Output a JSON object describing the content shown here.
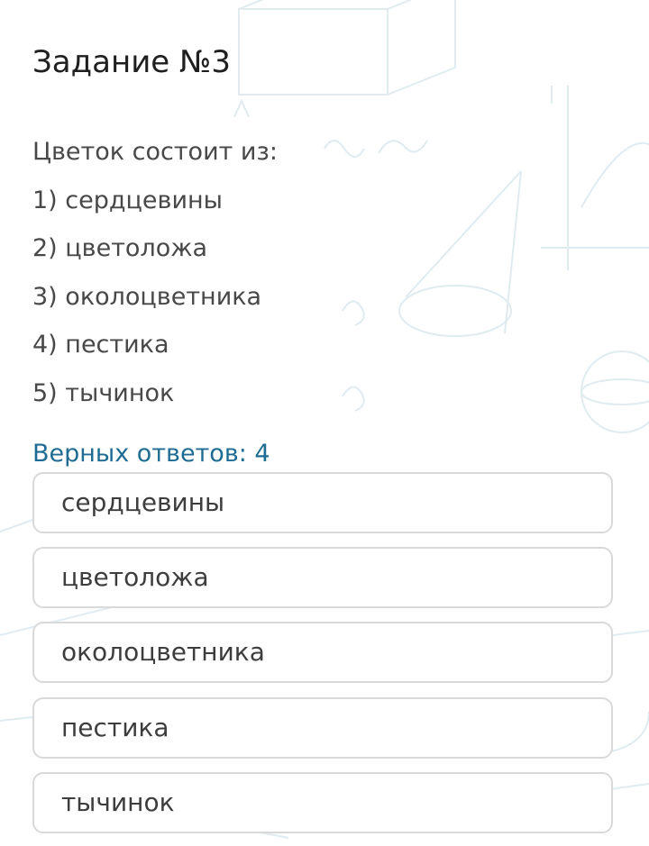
{
  "task": {
    "title": "Задание №3"
  },
  "question": {
    "prompt": "Цветок состоит из:",
    "items": [
      "1) сердцевины",
      "2) цветоложа",
      "3) околоцветника",
      "4) пестика",
      "5) тычинок"
    ]
  },
  "answers_count_label": "Верных ответов: 4",
  "options": [
    "сердцевины",
    "цветоложа",
    "околоцветника",
    "пестика",
    "тычинок"
  ],
  "colors": {
    "accent": "#1e6c93",
    "text": "#484848",
    "option_border": "#d9d9d9",
    "background_decoration": "#dbe8ee"
  }
}
